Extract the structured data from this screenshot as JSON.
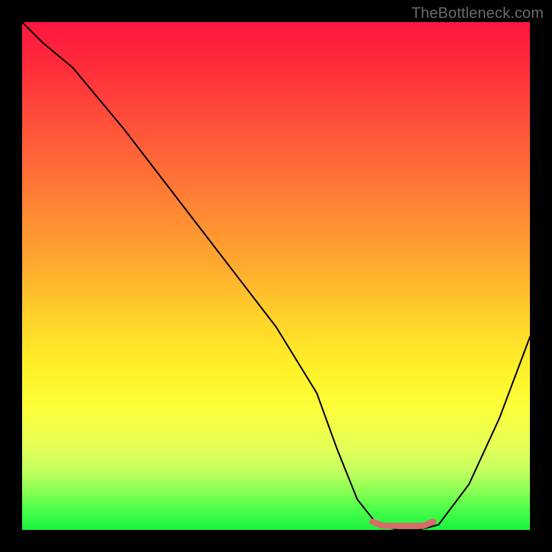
{
  "watermark": "TheBottleneck.com",
  "chart_data": {
    "type": "line",
    "title": "",
    "xlabel": "",
    "ylabel": "",
    "xlim": [
      0,
      100
    ],
    "ylim": [
      0,
      100
    ],
    "series": [
      {
        "name": "curve",
        "x": [
          0,
          4,
          10,
          20,
          30,
          40,
          50,
          58,
          62,
          66,
          70,
          74,
          78,
          82,
          88,
          94,
          100
        ],
        "y": [
          100,
          96,
          91,
          79,
          66,
          53,
          40,
          27,
          16,
          6,
          1,
          0,
          0,
          1,
          9,
          22,
          38
        ]
      }
    ],
    "flat_bottom": {
      "x_start": 70,
      "x_end": 80,
      "y": 0
    },
    "colors": {
      "curve": "#000000",
      "flat_segment": "#d86a6a",
      "background_top": "#ff163f",
      "background_bottom": "#18f23e",
      "frame": "#000000"
    }
  }
}
